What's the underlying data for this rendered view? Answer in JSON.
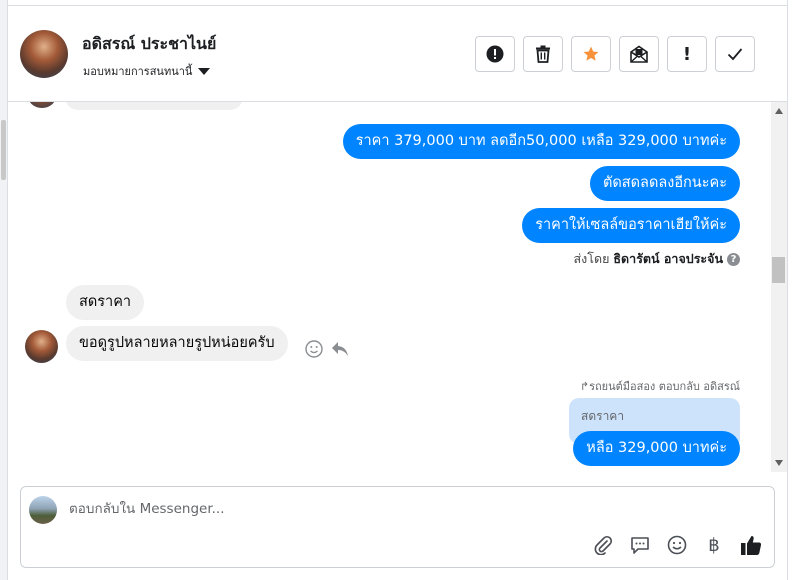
{
  "header": {
    "contact_name": "อดิสรณ์ ประชาไนย์",
    "assign_label": "มอบหมายการสนทนานี้",
    "toolbar": [
      {
        "name": "report-spam",
        "icon": "alert-circle-icon"
      },
      {
        "name": "delete",
        "icon": "trash-icon"
      },
      {
        "name": "star",
        "icon": "star-icon",
        "color": "#f7923b"
      },
      {
        "name": "mark-unread",
        "icon": "envelope-open-icon"
      },
      {
        "name": "follow-up",
        "icon": "exclamation-icon"
      },
      {
        "name": "done",
        "icon": "check-icon"
      }
    ]
  },
  "messages": {
    "out_1": "ราคา 379,000 บาท ลดอีก50,000 เหลือ 329,000 บาทค่ะ",
    "out_2": "ตัดสดลดลงอีกนะคะ",
    "out_3": "ราคาให้เซลล์ขอราคาเฮียให้ค่ะ",
    "sent_by_prefix": "ส่งโดย",
    "sent_by_name": "ธิดารัตน์ อาจประจัน",
    "in_1": "สดราคา",
    "in_2": "ขอดูรูปหลายหลายรูปหน่อยครับ",
    "reply_context": "รถยนต์มือสอง ตอบกลับ อดิสรณ์",
    "quoted_text": "สดราคา",
    "out_4": "หลือ 329,000 บาทค่ะ"
  },
  "composer": {
    "placeholder": "ตอบกลับใน Messenger...",
    "tools": [
      "paperclip-icon",
      "chat-bubble-icon",
      "emoji-icon",
      "baht-icon",
      "thumbs-up-icon"
    ],
    "baht_symbol": "฿"
  },
  "colors": {
    "accent": "#0084ff",
    "bubble_in": "#f0f0f0",
    "quoted_bg": "#cde3fb"
  }
}
